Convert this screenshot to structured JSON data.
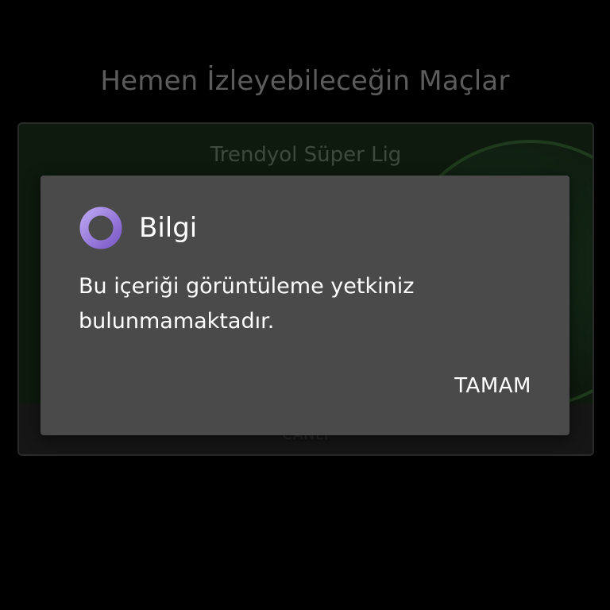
{
  "background_page": {
    "title": "Hemen İzleyebileceğin Maçlar",
    "match_card": {
      "league": "Trendyol Süper Lig",
      "footer_label": "CANLI"
    }
  },
  "dialog": {
    "icon": "purple-ring-icon",
    "title": "Bilgi",
    "message": "Bu içeriği görüntüleme yetkiniz bulunmamaktadır.",
    "ok_button": "TAMAM"
  },
  "colors": {
    "background": "#000000",
    "dialog_background": "#4a4a4a",
    "dialog_text": "#ffffff",
    "icon_accent": "#8f6fd8",
    "card_accent": "#1f3a1c"
  }
}
